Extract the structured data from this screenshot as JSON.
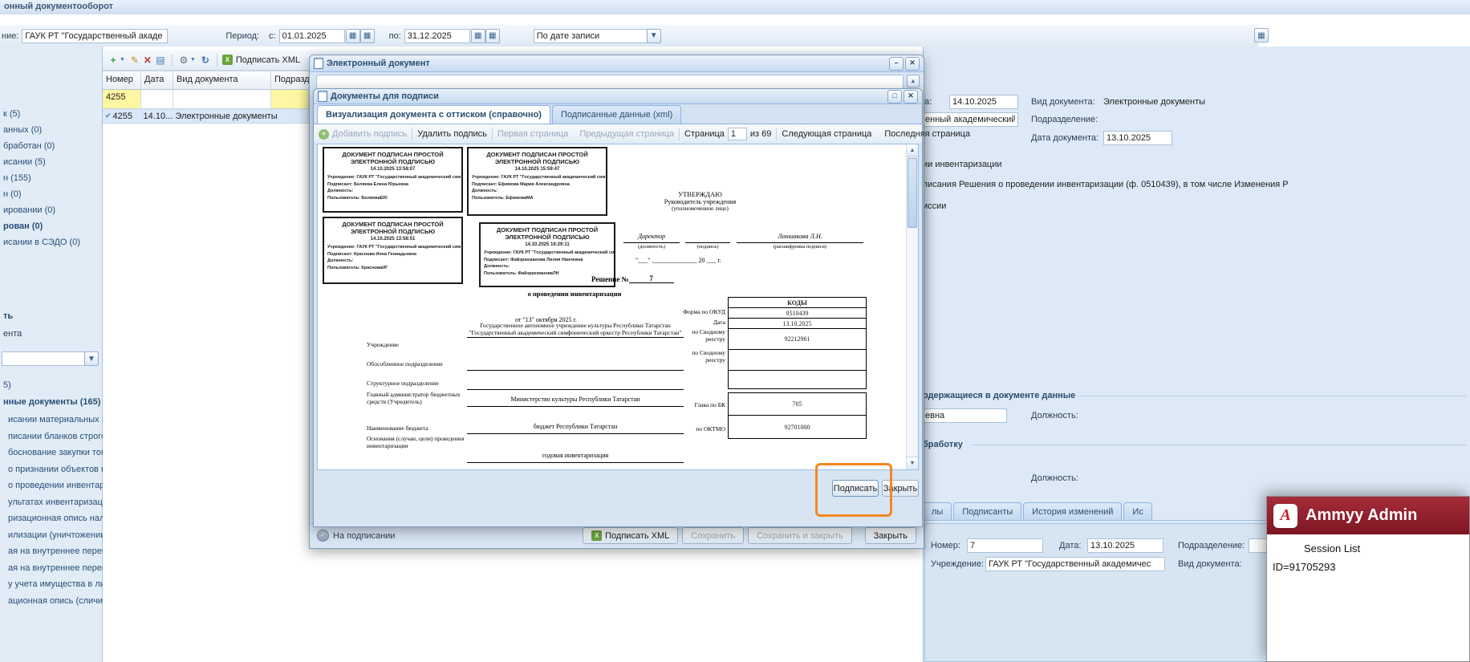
{
  "app": {
    "title": "онный документооборот"
  },
  "filters": {
    "institution_label": "ние:",
    "institution_value": "ГАУК РТ \"Государственный акаде",
    "period_label": "Период:",
    "from_label": "с:",
    "from_value": "01.01.2025",
    "to_label": "по:",
    "to_value": "31.12.2025",
    "sort_value": "По дате записи"
  },
  "sidebar": {
    "top_items": [
      "к (5)",
      "анных (0)",
      "бработан (0)",
      "исании (5)",
      "н (155)",
      "н (0)",
      "ировании (0)",
      "рован (0)",
      "исании в СЭДО (0)"
    ],
    "section_label1": "ть",
    "section_label2": "ента",
    "count_label": "5)",
    "docs_bold": "нные документы (165)",
    "items": [
      "исании материальных запа...",
      "писании бланков строгой от...",
      "боснование закупки товар...",
      "о признании объектов не...",
      "о проведении инвентариз...",
      "ультатах инвентаризации...",
      "ризационная опись налич...",
      "илизации (уничтожении) ...",
      "ая на внутреннее перемещ...",
      "ая на внутреннее перемещ...",
      "у учета имущества в лично...",
      "ационная опись (сличи..."
    ]
  },
  "grid": {
    "sign_xml_button": "Подписать XML",
    "columns": [
      "Номер",
      "Дата",
      "Вид документа",
      "Подраздел"
    ],
    "filter_number": "4255",
    "row": {
      "number": "4255",
      "date": "14.10...",
      "type": "Электронные документы"
    }
  },
  "details": {
    "date_label": "а:",
    "date_value": "14.10.2025",
    "doctype_label": "Вид документа:",
    "doctype_value": "Электронные документы",
    "institution_value": "енный академический",
    "department_label": "Подразделение:",
    "docdate_label": "Дата документа:",
    "docdate_value": "13.10.2025",
    "line1": "ии инвентаризации",
    "line2": "писания Решения о проведении инвентаризации (ф. 0510439), в том числе Изменения Р",
    "line3": "иссии",
    "section_data": "одержащиеся в документе данные",
    "name_value": "евна",
    "position_label": "Должность:",
    "section_processing": "бработку",
    "position2_label": "Должность:",
    "tabs": [
      "лы",
      "Подписанты",
      "История изменений",
      "Ис"
    ],
    "number_label": "Номер:",
    "number_value": "7",
    "date2_label": "Дата:",
    "date2_value": "13.10.2025",
    "department2_label": "Подразделение:",
    "institution_label": "Учреждение:",
    "institution2_value": "ГАУК РТ \"Государственный академичес",
    "doctype2_label": "Вид документа:"
  },
  "doc_window": {
    "title": "Электронный документ",
    "status": "На подписании",
    "sign_xml": "Подписать XML",
    "save": "Сохранить",
    "save_close": "Сохранить и закрыть",
    "close": "Закрыть"
  },
  "modal": {
    "title": "Документы для подписи",
    "tab1": "Визуализация документа с оттиском (справочно)",
    "tab2": "Подписанные данные (xml)",
    "add": "Добавить подпись",
    "remove": "Удалить подпись",
    "first": "Первая страница",
    "prev": "Предыдущая страница",
    "page_label": "Страница",
    "page_value": "1",
    "pages_total": "из 69",
    "next": "Следующая страница",
    "last": "Последняя страница",
    "sign": "Подписать",
    "close": "Закрыть"
  },
  "stamps": [
    {
      "title": "ДОКУМЕНТ ПОДПИСАН ПРОСТОЙ ЭЛЕКТРОННОЙ ПОДПИСЬЮ",
      "datetime": "14.10.2025 13:58:07",
      "org": "Учреждение: ГАУК РТ \"Государственный академический сим",
      "signer": "Подписант: Беляева Елена Юрьевна",
      "position": "Должность:",
      "user": "Пользователь: БеляеваЕЮ"
    },
    {
      "title": "ДОКУМЕНТ ПОДПИСАН ПРОСТОЙ ЭЛЕКТРОННОЙ ПОДПИСЬЮ",
      "datetime": "14.10.2025 15:59:47",
      "org": "Учреждение: ГАУК РТ \"Государственный академический сим",
      "signer": "Подписант: Ефимова Мария Александровна",
      "position": "Должность:",
      "user": "Пользователь: ЕфимоваМА"
    },
    {
      "title": "ДОКУМЕНТ ПОДПИСАН ПРОСТОЙ ЭЛЕКТРОННОЙ ПОДПИСЬЮ",
      "datetime": "14.10.2025 13:58:51",
      "org": "Учреждение: ГАУК РТ \"Государственный академический сим",
      "signer": "Подписант: Краснова Инна Геннадьевна",
      "position": "Должность:",
      "user": "Пользователь: КрасноваИГ"
    },
    {
      "title": "ДОКУМЕНТ ПОДПИСАН ПРОСТОЙ ЭЛЕКТРОННОЙ ПОДПИСЬЮ",
      "datetime": "14.10.2025 16:29:11",
      "org": "Учреждение: ГАУК РТ \"Государственный академический сим",
      "signer": "Подписант: Файзрахманова Лилия Наилевна",
      "position": "Должность:",
      "user": "Пользователь: ФайзрахмановаЛН"
    }
  ],
  "document": {
    "approve1": "УТВЕРЖДАЮ",
    "approve2": "Руководитель учреждения",
    "approve3": "(уполномоченное лицо)",
    "position_value": "Директор",
    "position_caption": "(должность)",
    "sign_caption": "(подпись)",
    "name_value": "Лоншакова Л.Н.",
    "name_caption": "(расшифровка подписи)",
    "date_blank": "\"___\" ______________ 20 ___ г.",
    "decision": "Решение №",
    "decision_no": "7",
    "subtitle": "о проведении инвентаризации",
    "codes_header": "КОДЫ",
    "okud_label": "Форма по ОКУД",
    "okud_value": "0510439",
    "date_label": "Дата",
    "date_value": "13.10.2025",
    "from_date": "от \"13\" октября 2025 г.",
    "org_name": "Государственное автономное учреждение культуры Республики Татарстан \"Государственный академический симфонический оркестр Республики Татарстан\"",
    "institution_label": "Учреждение",
    "registry_label": "по Сводному реестру",
    "registry_value": "92212961",
    "separate_label": "Обособленное подразделение",
    "registry2_label": "по Сводному реестру",
    "structural_label": "Структурное подразделение",
    "admin_label": "Главный администратор бюджетных средств (Учредитель)",
    "admin_value": "Министерство культуры Республики Татарстан",
    "bk_label": "Глава по БК",
    "bk_value": "705",
    "budget_label": "Наименование бюджета",
    "budget_value": "бюджет Республики Татарстан",
    "oktmo_label": "по ОКТМО",
    "oktmo_value": "92701000",
    "grounds_label": "Основания (случаи, цели) проведения инвентаризации",
    "grounds_value": "годовая инвентаризация"
  },
  "ammyy": {
    "title": "Ammyy Admin",
    "session": "Session List",
    "id": "ID=91705293"
  }
}
